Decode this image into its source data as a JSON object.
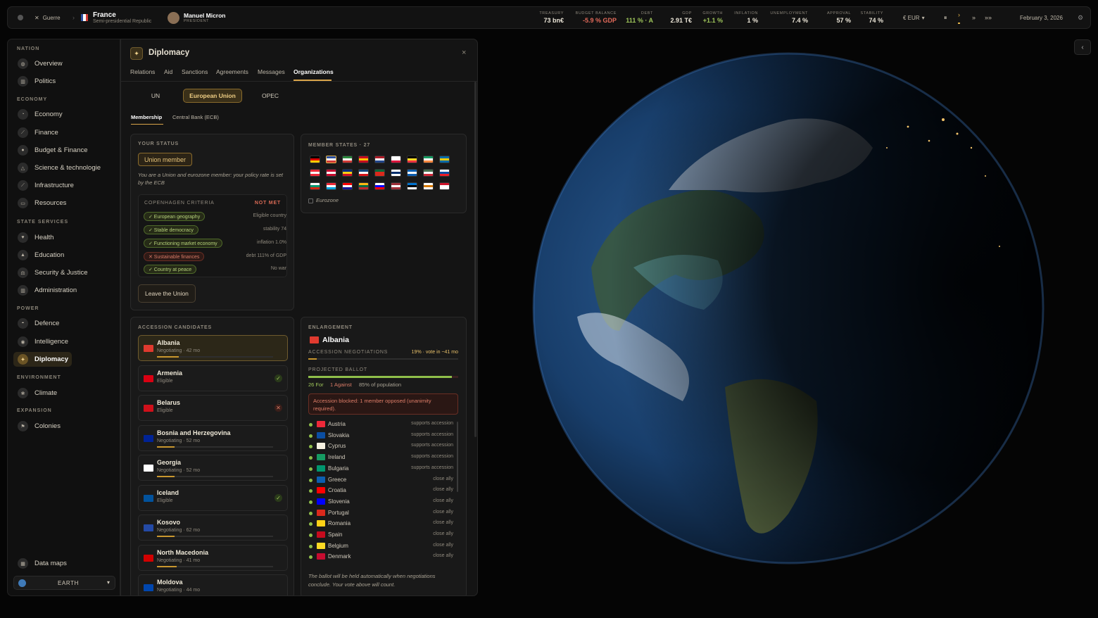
{
  "topbar": {
    "mode": "Guerre",
    "country": "France",
    "regime": "Semi-presidential Republic",
    "leader": "Manuel Micron",
    "leader_role": "PRESIDENT",
    "currency": "€ EUR",
    "date": "February 3, 2026",
    "stats": [
      {
        "label": "TREASURY",
        "value": "73 bn€"
      },
      {
        "label": "BUDGET BALANCE",
        "value": "-5.9 % GDP"
      },
      {
        "label": "DEBT",
        "value": "111 % · A"
      },
      {
        "label": "GDP",
        "value": "2.91 T€"
      },
      {
        "label": "GROWTH",
        "value": "+1.1 %"
      },
      {
        "label": "INFLATION",
        "value": "1 %"
      },
      {
        "label": "UNEMPLOYMENT",
        "value": "7.4 %"
      },
      {
        "label": "APPROVAL",
        "value": "57 %"
      },
      {
        "label": "STABILITY",
        "value": "74 %"
      }
    ]
  },
  "sidebar": {
    "sections": [
      "NATION",
      "ECONOMY",
      "STATE SERVICES",
      "POWER",
      "ENVIRONMENT",
      "EXPANSION"
    ],
    "items": [
      "Overview",
      "Politics",
      "Economy",
      "Finance",
      "Budget & Finance",
      "Science & technologie",
      "Infrastructure",
      "Resources",
      "Health",
      "Education",
      "Security & Justice",
      "Administration",
      "Defence",
      "Intelligence",
      "Diplomacy",
      "Climate",
      "Colonies"
    ],
    "data_maps": "Data maps",
    "globe": "EARTH"
  },
  "panel": {
    "title": "Diplomacy",
    "tabs": [
      "Relations",
      "Aid",
      "Sanctions",
      "Agreements",
      "Messages",
      "Organizations"
    ],
    "orgs": [
      "UN",
      "European Union",
      "OPEC"
    ],
    "subtabs": [
      "Membership",
      "Central Bank (ECB)"
    ],
    "status": {
      "header": "YOUR STATUS",
      "badge": "Union member",
      "desc": "You are a Union and eurozone member: your policy rate is set by the ECB",
      "criteria_header": "COPENHAGEN CRITERIA",
      "criteria_state": "NOT MET",
      "criteria": [
        {
          "label": "✓ European geography",
          "value": "Eligible country"
        },
        {
          "label": "✓ Stable democracy",
          "value": "stability 74"
        },
        {
          "label": "✓ Functioning market economy",
          "value": "inflation 1.0%"
        },
        {
          "label": "✕ Sustainable finances",
          "value": "debt 111% of GDP"
        },
        {
          "label": "✓ Country at peace",
          "value": "No war"
        }
      ],
      "leave": "Leave the Union"
    },
    "members": {
      "header": "MEMBER STATES · 27",
      "eurozone": "Eurozone"
    },
    "candidates": {
      "header": "ACCESSION CANDIDATES",
      "items": [
        {
          "name": "Albania",
          "status": "Negotiating · 42 mo",
          "progress": 0.19
        },
        {
          "name": "Armenia",
          "status": "Eligible"
        },
        {
          "name": "Belarus",
          "status": "Eligible"
        },
        {
          "name": "Bosnia and Herzegovina",
          "status": "Negotiating · 52 mo",
          "progress": 0.15
        },
        {
          "name": "Georgia",
          "status": "Negotiating · 52 mo",
          "progress": 0.15
        },
        {
          "name": "Iceland",
          "status": "Eligible"
        },
        {
          "name": "Kosovo",
          "status": "Negotiating · 62 mo",
          "progress": 0.15
        },
        {
          "name": "North Macedonia",
          "status": "Negotiating · 41 mo",
          "progress": 0.17
        },
        {
          "name": "Moldova",
          "status": "Negotiating · 44 mo",
          "progress": 0.2
        }
      ]
    },
    "enlargement": {
      "header": "ENLARGEMENT",
      "country": "Albania",
      "neg_label": "ACCESSION NEGOTIATIONS",
      "neg_value": "19% · vote in ~41 mo",
      "neg_progress": 0.19,
      "ballot_label": "PROJECTED BALLOT",
      "ballot_for": "26 For",
      "ballot_against": "1 Against",
      "ballot_pop": "85% of population",
      "ballot_share": 0.96,
      "warning": "Accession blocked: 1 member opposed (unanimity required).",
      "votes": [
        {
          "name": "Austria",
          "stance": "supports accession"
        },
        {
          "name": "Slovakia",
          "stance": "supports accession"
        },
        {
          "name": "Cyprus",
          "stance": "supports accession"
        },
        {
          "name": "Ireland",
          "stance": "supports accession"
        },
        {
          "name": "Bulgaria",
          "stance": "supports accession"
        },
        {
          "name": "Greece",
          "stance": "close ally"
        },
        {
          "name": "Croatia",
          "stance": "close ally"
        },
        {
          "name": "Slovenia",
          "stance": "close ally"
        },
        {
          "name": "Portugal",
          "stance": "close ally"
        },
        {
          "name": "Romania",
          "stance": "close ally"
        },
        {
          "name": "Spain",
          "stance": "close ally"
        },
        {
          "name": "Belgium",
          "stance": "close ally"
        },
        {
          "name": "Denmark",
          "stance": "close ally"
        }
      ],
      "footnote": "The ballot will be held automatically when negotiations conclude. Your vote above will count."
    }
  }
}
